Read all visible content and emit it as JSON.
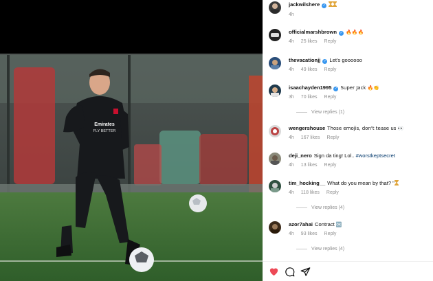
{
  "post": {
    "author": "jackwilshere",
    "caption_emoji": "hourglass hourglass",
    "time": "4h"
  },
  "comments": [
    {
      "user": "officialmarshbrown",
      "verified": true,
      "text": "🔥🔥🔥",
      "time": "4h",
      "likes": "25 likes",
      "reply": "Reply"
    },
    {
      "user": "thevacationjj",
      "verified": true,
      "text": "Let's goooooo",
      "time": "4h",
      "likes": "49 likes",
      "reply": "Reply"
    },
    {
      "user": "isaachayden1995",
      "verified": true,
      "text": "Super Jack 🔥👏",
      "time": "3h",
      "likes": "70 likes",
      "reply": "Reply",
      "view_replies": "View replies (1)"
    },
    {
      "user": "wengershouse",
      "verified": false,
      "text": "Those emojis, don't tease us 👀",
      "time": "4h",
      "likes": "167 likes",
      "reply": "Reply"
    },
    {
      "user": "deji_nero",
      "verified": false,
      "text": "Sign da ting! Lol.. ",
      "tag": "#worstkeptsecret",
      "time": "4h",
      "likes": "13 likes",
      "reply": "Reply"
    },
    {
      "user": "tim_hocking__",
      "verified": false,
      "text": "What do you mean by that? \"",
      "time": "4h",
      "likes": "118 likes",
      "reply": "Reply",
      "view_replies": "View replies (4)"
    },
    {
      "user": "azor7ahai",
      "verified": false,
      "text": "Contract ",
      "badge": "🆗",
      "time": "4h",
      "likes": "93 likes",
      "reply": "Reply",
      "view_replies": "View replies (4)"
    }
  ],
  "actions": {
    "like_icon": "heart-icon",
    "comment_icon": "comment-icon",
    "share_icon": "paper-plane-icon"
  },
  "colors": {
    "verified": "#3897f0",
    "like": "#ed4956",
    "hashtag": "#00376b"
  }
}
